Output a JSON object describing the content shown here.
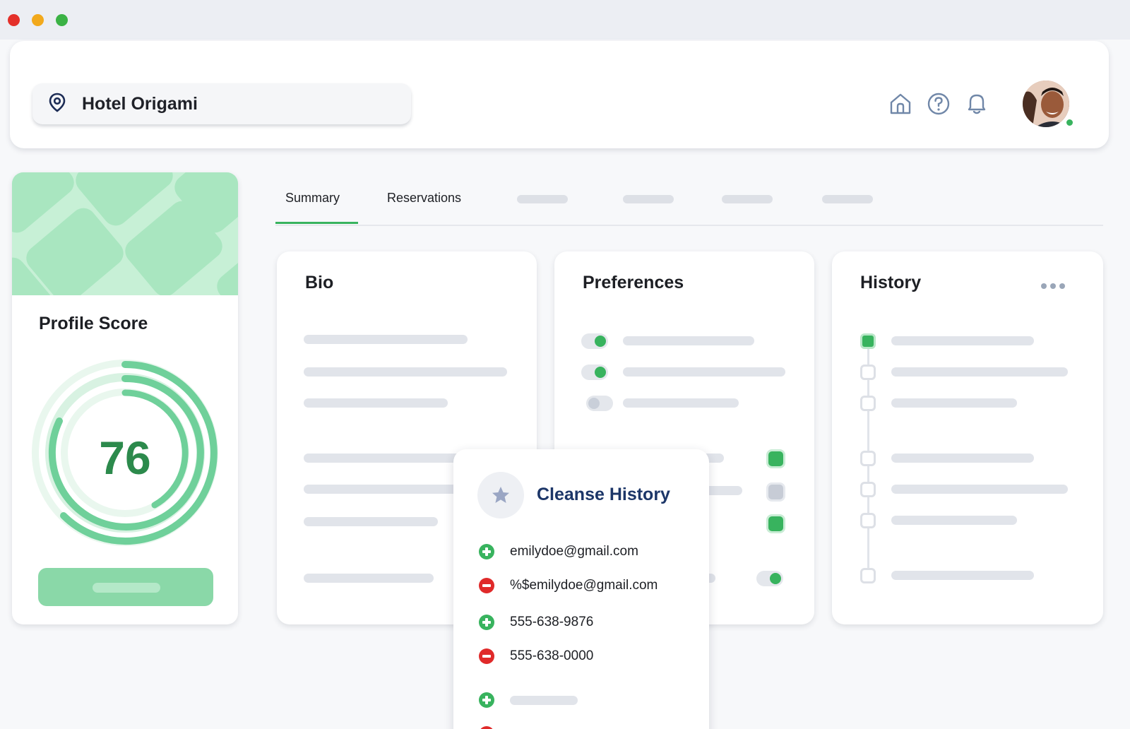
{
  "window": {
    "controls": [
      {
        "name": "close",
        "color": "#e4302a"
      },
      {
        "name": "minimize",
        "color": "#f2a91c"
      },
      {
        "name": "maximize",
        "color": "#3bb245"
      }
    ]
  },
  "header": {
    "location": {
      "icon": "map-pin-icon",
      "label": "Hotel Origami"
    },
    "icons": [
      "home-icon",
      "help-icon",
      "bell-icon"
    ],
    "user": {
      "avatar": "user-avatar",
      "status": "online",
      "status_color": "#38b35e"
    }
  },
  "profile_score": {
    "title": "Profile Score",
    "value": "76",
    "accent": "#6fd09a"
  },
  "tabs": [
    {
      "label": "Summary",
      "active": true
    },
    {
      "label": "Reservations",
      "active": false
    }
  ],
  "cards": {
    "bio": {
      "title": "Bio"
    },
    "preferences": {
      "title": "Preferences"
    },
    "history": {
      "title": "History",
      "menu_icon": "more-horizontal-icon"
    }
  },
  "popup": {
    "icon": "star-icon",
    "title": "Cleanse History",
    "items": [
      {
        "action": "add",
        "text": "emilydoe@gmail.com"
      },
      {
        "action": "remove",
        "text": "%$emilydoe@gmail.com"
      },
      {
        "action": "add",
        "text": "555-638-9876"
      },
      {
        "action": "remove",
        "text": "555-638-0000"
      },
      {
        "action": "add",
        "text": ""
      }
    ]
  },
  "colors": {
    "brand_green": "#38b35e",
    "remove_red": "#e02a2a",
    "title_navy": "#1c3668"
  }
}
